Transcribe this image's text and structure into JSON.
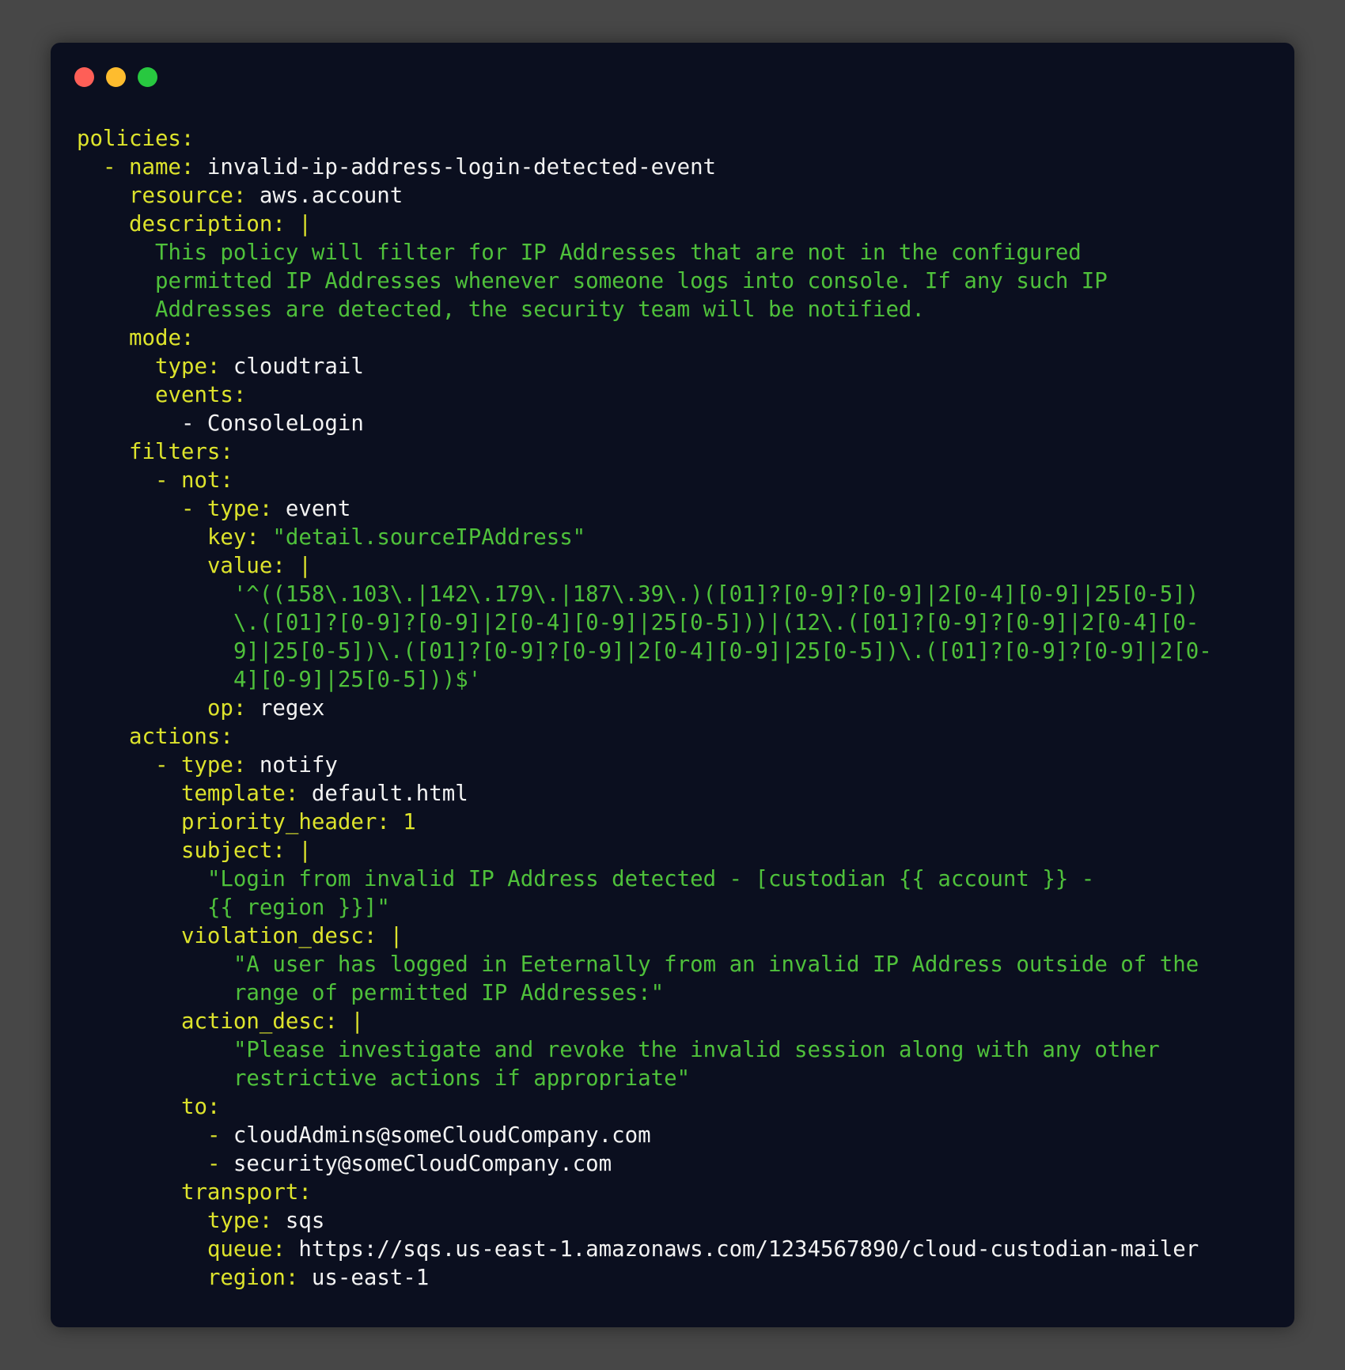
{
  "window": {
    "controls": [
      {
        "name": "close",
        "color": "#fe5f57"
      },
      {
        "name": "minimize",
        "color": "#febc2e"
      },
      {
        "name": "maximize",
        "color": "#28c840"
      }
    ]
  },
  "colors": {
    "key": "#dde32c",
    "value": "#f2f2f2",
    "string": "#4fc13b",
    "background": "#0b0f1f"
  },
  "code": {
    "language": "yaml",
    "lines": [
      {
        "indent": 0,
        "segs": [
          {
            "t": "policies:",
            "c": "k"
          }
        ]
      },
      {
        "indent": 2,
        "segs": [
          {
            "t": "- name:",
            "c": "k"
          },
          {
            "t": " invalid-ip-address-login-detected-event",
            "c": "v"
          }
        ]
      },
      {
        "indent": 4,
        "segs": [
          {
            "t": "resource:",
            "c": "k"
          },
          {
            "t": " aws.account",
            "c": "v"
          }
        ]
      },
      {
        "indent": 4,
        "segs": [
          {
            "t": "description: |",
            "c": "k"
          }
        ]
      },
      {
        "indent": 6,
        "segs": [
          {
            "t": "This policy will filter for IP Addresses that are not in the configured",
            "c": "s"
          }
        ]
      },
      {
        "indent": 6,
        "segs": [
          {
            "t": "permitted IP Addresses whenever someone logs into console. If any such IP",
            "c": "s"
          }
        ]
      },
      {
        "indent": 6,
        "segs": [
          {
            "t": "Addresses are detected, the security team will be notified.",
            "c": "s"
          }
        ]
      },
      {
        "indent": 4,
        "segs": [
          {
            "t": "mode:",
            "c": "k"
          }
        ]
      },
      {
        "indent": 6,
        "segs": [
          {
            "t": "type:",
            "c": "k"
          },
          {
            "t": " cloudtrail",
            "c": "v"
          }
        ]
      },
      {
        "indent": 6,
        "segs": [
          {
            "t": "events:",
            "c": "k"
          }
        ]
      },
      {
        "indent": 8,
        "segs": [
          {
            "t": "- ConsoleLogin",
            "c": "v"
          }
        ]
      },
      {
        "indent": 4,
        "segs": [
          {
            "t": "filters:",
            "c": "k"
          }
        ]
      },
      {
        "indent": 6,
        "segs": [
          {
            "t": "- not:",
            "c": "k"
          }
        ]
      },
      {
        "indent": 8,
        "segs": [
          {
            "t": "- type:",
            "c": "k"
          },
          {
            "t": " event",
            "c": "v"
          }
        ]
      },
      {
        "indent": 10,
        "segs": [
          {
            "t": "key:",
            "c": "k"
          },
          {
            "t": " \"detail.sourceIPAddress\"",
            "c": "s"
          }
        ]
      },
      {
        "indent": 10,
        "segs": [
          {
            "t": "value: |",
            "c": "k"
          }
        ]
      },
      {
        "indent": 12,
        "segs": [
          {
            "t": "'^((158\\.103\\.|142\\.179\\.|187\\.39\\.)([01]?[0-9]?[0-9]|2[0-4][0-9]|25[0-5])",
            "c": "s"
          }
        ]
      },
      {
        "indent": 12,
        "segs": [
          {
            "t": "\\.([01]?[0-9]?[0-9]|2[0-4][0-9]|25[0-5]))|(12\\.([01]?[0-9]?[0-9]|2[0-4][0-",
            "c": "s"
          }
        ]
      },
      {
        "indent": 12,
        "segs": [
          {
            "t": "9]|25[0-5])\\.([01]?[0-9]?[0-9]|2[0-4][0-9]|25[0-5])\\.([01]?[0-9]?[0-9]|2[0-",
            "c": "s"
          }
        ]
      },
      {
        "indent": 12,
        "segs": [
          {
            "t": "4][0-9]|25[0-5]))$'",
            "c": "s"
          }
        ]
      },
      {
        "indent": 10,
        "segs": [
          {
            "t": "op:",
            "c": "k"
          },
          {
            "t": " regex",
            "c": "v"
          }
        ]
      },
      {
        "indent": 4,
        "segs": [
          {
            "t": "actions:",
            "c": "k"
          }
        ]
      },
      {
        "indent": 6,
        "segs": [
          {
            "t": "- type:",
            "c": "k"
          },
          {
            "t": " notify",
            "c": "v"
          }
        ]
      },
      {
        "indent": 8,
        "segs": [
          {
            "t": "template:",
            "c": "k"
          },
          {
            "t": " default.html",
            "c": "v"
          }
        ]
      },
      {
        "indent": 8,
        "segs": [
          {
            "t": "priority_header: 1",
            "c": "k"
          }
        ]
      },
      {
        "indent": 8,
        "segs": [
          {
            "t": "subject: |",
            "c": "k"
          }
        ]
      },
      {
        "indent": 10,
        "segs": [
          {
            "t": "\"Login from invalid IP Address detected - [custodian {{ account }} -",
            "c": "s"
          }
        ]
      },
      {
        "indent": 10,
        "segs": [
          {
            "t": "{{ region }}]\"",
            "c": "s"
          }
        ]
      },
      {
        "indent": 8,
        "segs": [
          {
            "t": "violation_desc: |",
            "c": "k"
          }
        ]
      },
      {
        "indent": 12,
        "segs": [
          {
            "t": "\"A user has logged in Eeternally from an invalid IP Address outside of the",
            "c": "s"
          }
        ]
      },
      {
        "indent": 12,
        "segs": [
          {
            "t": "range of permitted IP Addresses:\"",
            "c": "s"
          }
        ]
      },
      {
        "indent": 8,
        "segs": [
          {
            "t": "action_desc: |",
            "c": "k"
          }
        ]
      },
      {
        "indent": 12,
        "segs": [
          {
            "t": "\"Please investigate and revoke the invalid session along with any other",
            "c": "s"
          }
        ]
      },
      {
        "indent": 12,
        "segs": [
          {
            "t": "restrictive actions if appropriate\"",
            "c": "s"
          }
        ]
      },
      {
        "indent": 8,
        "segs": [
          {
            "t": "to:",
            "c": "k"
          }
        ]
      },
      {
        "indent": 10,
        "segs": [
          {
            "t": "-",
            "c": "k"
          },
          {
            "t": " cloudAdmins@someCloudCompany.com",
            "c": "v"
          }
        ]
      },
      {
        "indent": 10,
        "segs": [
          {
            "t": "-",
            "c": "k"
          },
          {
            "t": " security@someCloudCompany.com",
            "c": "v"
          }
        ]
      },
      {
        "indent": 8,
        "segs": [
          {
            "t": "transport:",
            "c": "k"
          }
        ]
      },
      {
        "indent": 10,
        "segs": [
          {
            "t": "type:",
            "c": "k"
          },
          {
            "t": " sqs",
            "c": "v"
          }
        ]
      },
      {
        "indent": 10,
        "segs": [
          {
            "t": "queue:",
            "c": "k"
          },
          {
            "t": " https://sqs.us-east-1.amazonaws.com/1234567890/cloud-custodian-mailer",
            "c": "v"
          }
        ]
      },
      {
        "indent": 10,
        "segs": [
          {
            "t": "region:",
            "c": "k"
          },
          {
            "t": " us-east-1",
            "c": "v"
          }
        ]
      }
    ]
  }
}
